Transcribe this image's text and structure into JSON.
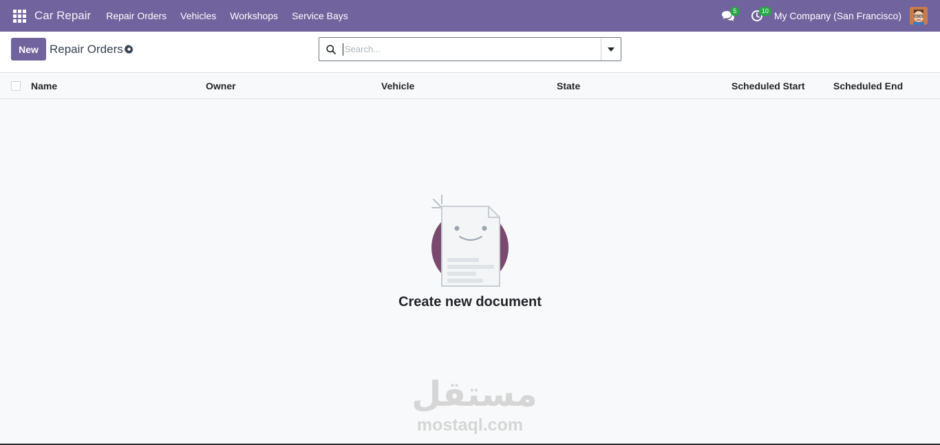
{
  "navbar": {
    "app_name": "Car Repair",
    "menu": [
      {
        "label": "Repair Orders"
      },
      {
        "label": "Vehicles"
      },
      {
        "label": "Workshops"
      },
      {
        "label": "Service Bays"
      }
    ],
    "messages_count": "5",
    "activities_count": "10",
    "company": "My Company (San Francisco)",
    "accent_color": "#71639e"
  },
  "control_panel": {
    "new_label": "New",
    "breadcrumb": "Repair Orders",
    "search_placeholder": "Search..."
  },
  "list": {
    "columns": [
      "Name",
      "Owner",
      "Vehicle",
      "State",
      "Scheduled Start",
      "Scheduled End"
    ],
    "rows": []
  },
  "empty_state": {
    "title": "Create new document"
  },
  "watermark": {
    "arabic": "مستقل",
    "latin": "mostaql.com"
  }
}
